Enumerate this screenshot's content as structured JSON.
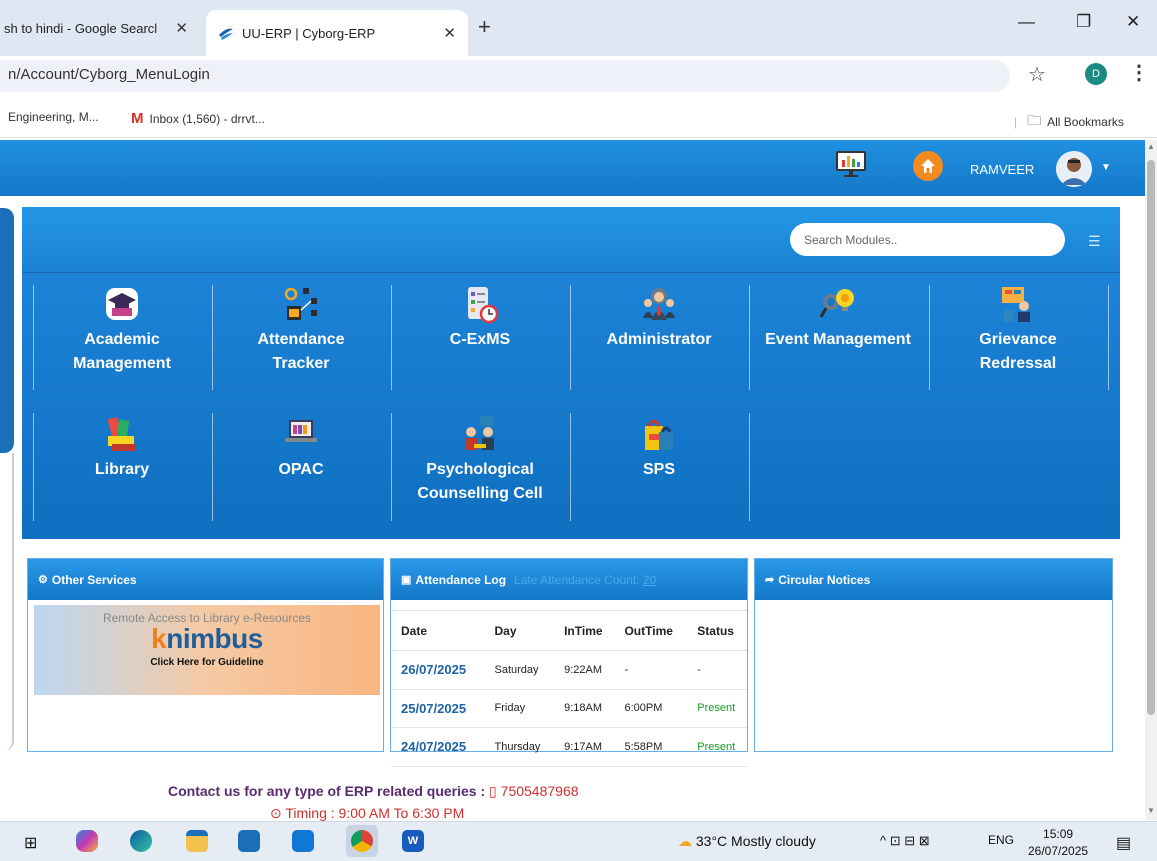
{
  "browser": {
    "tabs": [
      {
        "title": "sh to hindi - Google Searcl",
        "active": false
      },
      {
        "title": "UU-ERP | Cyborg-ERP",
        "active": true
      }
    ],
    "url": "n/Account/Cyborg_MenuLogin",
    "profile_initial": "D",
    "bookmarks": [
      "Engineering, M...",
      "Inbox (1,560) - drrvt..."
    ],
    "all_bookmarks": "All Bookmarks"
  },
  "header": {
    "username": "RAMVEER",
    "icons": [
      "monitor-chart-icon",
      "home-icon",
      "avatar",
      "caret-down-icon"
    ]
  },
  "modules": {
    "search_placeholder": "Search Modules..",
    "row1": [
      {
        "label1": "Academic",
        "label2": "Management",
        "icon": "graduation-cap-icon"
      },
      {
        "label1": "Attendance",
        "label2": "Tracker",
        "icon": "attendance-network-icon"
      },
      {
        "label1": "C-ExMS",
        "label2": "",
        "icon": "checklist-clock-icon"
      },
      {
        "label1": "Administrator",
        "label2": "",
        "icon": "admin-people-icon"
      },
      {
        "label1": "Event Management",
        "label2": "",
        "icon": "gears-bulb-icon"
      },
      {
        "label1": "Grievance",
        "label2": "Redressal",
        "icon": "grievance-board-icon"
      }
    ],
    "row2": [
      {
        "label1": "Library",
        "label2": "",
        "icon": "books-icon"
      },
      {
        "label1": "OPAC",
        "label2": "",
        "icon": "laptop-books-icon"
      },
      {
        "label1": "Psychological",
        "label2": "Counselling Cell",
        "icon": "counselling-icon"
      },
      {
        "label1": "SPS",
        "label2": "",
        "icon": "shopping-bags-icon"
      }
    ]
  },
  "other_services": {
    "title": "Other Services",
    "knimbus_top": "Remote Access to Library e-Resources",
    "knimbus_brand": "knimbus",
    "knimbus_guide": "Click Here for Guideline"
  },
  "attendance": {
    "title": "Attendance Log",
    "late_label": "Late Attendance Count:",
    "late_count": "20",
    "columns": [
      "Date",
      "Day",
      "InTime",
      "OutTime",
      "Status"
    ],
    "rows": [
      [
        "26/07/2025",
        "Saturday",
        "9:22AM",
        "-",
        "-"
      ],
      [
        "25/07/2025",
        "Friday",
        "9:18AM",
        "6:00PM",
        "Present"
      ],
      [
        "24/07/2025",
        "Thursday",
        "9:17AM",
        "5:58PM",
        "Present"
      ]
    ]
  },
  "circular": {
    "title": "Circular Notices"
  },
  "footer": {
    "contact": "Contact us for any type of ERP related queries :",
    "phone": "7505487968",
    "timing": "Timing : 9:00 AM To 6:30 PM"
  },
  "taskbar": {
    "weather": "33°C  Mostly cloudy",
    "lang": "ENG",
    "time": "15:09",
    "date": "26/07/2025"
  },
  "colors": {
    "erp_blue": "#1478c8",
    "accent_orange": "#f58a1f",
    "present_green": "#1a9a2a"
  }
}
